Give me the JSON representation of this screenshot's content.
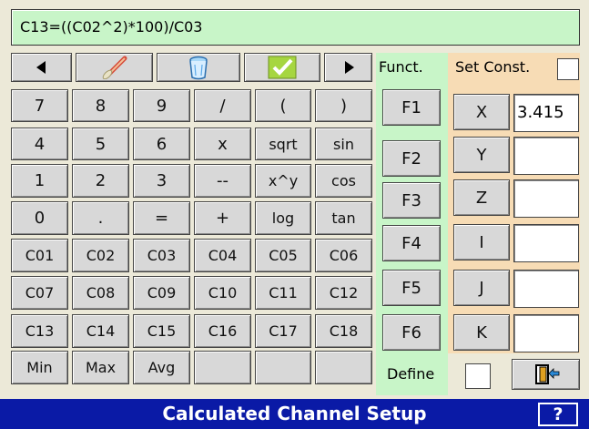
{
  "expression": "C13=((C02^2)*100)/C03",
  "toolbar": {
    "icons": [
      "left-arrow-icon",
      "brush-icon",
      "trash-icon",
      "checkmark-icon",
      "right-arrow-icon"
    ],
    "colors": {
      "check": "#a6d640",
      "trash": "#5aa8e8"
    }
  },
  "keypad": {
    "rows": [
      [
        "7",
        "8",
        "9",
        "/",
        "(",
        ")"
      ],
      [
        "4",
        "5",
        "6",
        "x",
        "sqrt",
        "sin"
      ],
      [
        "1",
        "2",
        "3",
        "--",
        "x^y",
        "cos"
      ],
      [
        "0",
        ".",
        "=",
        "+",
        "log",
        "tan"
      ],
      [
        "C01",
        "C02",
        "C03",
        "C04",
        "C05",
        "C06"
      ],
      [
        "C07",
        "C08",
        "C09",
        "C10",
        "C11",
        "C12"
      ],
      [
        "C13",
        "C14",
        "C15",
        "C16",
        "C17",
        "C18"
      ],
      [
        "Min",
        "Max",
        "Avg",
        "",
        "",
        ""
      ]
    ]
  },
  "functions": {
    "label": "Funct.",
    "buttons": [
      "F1",
      "F2",
      "F3",
      "F4",
      "F5",
      "F6"
    ]
  },
  "constants": {
    "label": "Set Const.",
    "items": [
      {
        "name": "X",
        "value": "3.415"
      },
      {
        "name": "Y",
        "value": ""
      },
      {
        "name": "Z",
        "value": ""
      },
      {
        "name": "I",
        "value": ""
      },
      {
        "name": "J",
        "value": ""
      },
      {
        "name": "K",
        "value": ""
      }
    ]
  },
  "define": {
    "label": "Define"
  },
  "status": {
    "title": "Calculated Channel Setup",
    "help_label": "?"
  },
  "colors": {
    "display_bg": "#c8f5c8",
    "funct_bg": "#c8f5c8",
    "const_bg": "#f7dcb5",
    "statusbar_bg": "#0a1aa6",
    "button_bg": "#d8d8d8"
  }
}
